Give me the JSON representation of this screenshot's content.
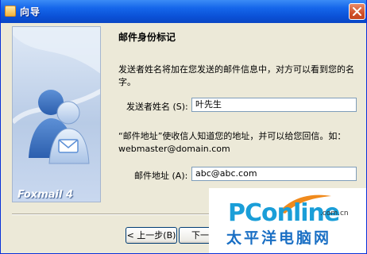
{
  "window": {
    "title": "向导"
  },
  "sidebar": {
    "brand": "Foxmail 4"
  },
  "page": {
    "heading": "邮件身份标记",
    "intro": "发送者姓名将加在您发送的邮件信息中，对方可以看到您的名字。",
    "name_label": "发送者姓名 (S):",
    "name_value": "叶先生",
    "email_hint": "“邮件地址”使收信人知道您的地址，并可以给您回信。如：webmaster@domain.com",
    "email_label": "邮件地址 (A):",
    "email_value": "abc@abc.com"
  },
  "buttons": {
    "back": "< 上一步(B)",
    "next": "下一步"
  },
  "watermark": {
    "logo": "PConline",
    "domain": ".com.cn",
    "cn": "太平洋电脑网"
  }
}
